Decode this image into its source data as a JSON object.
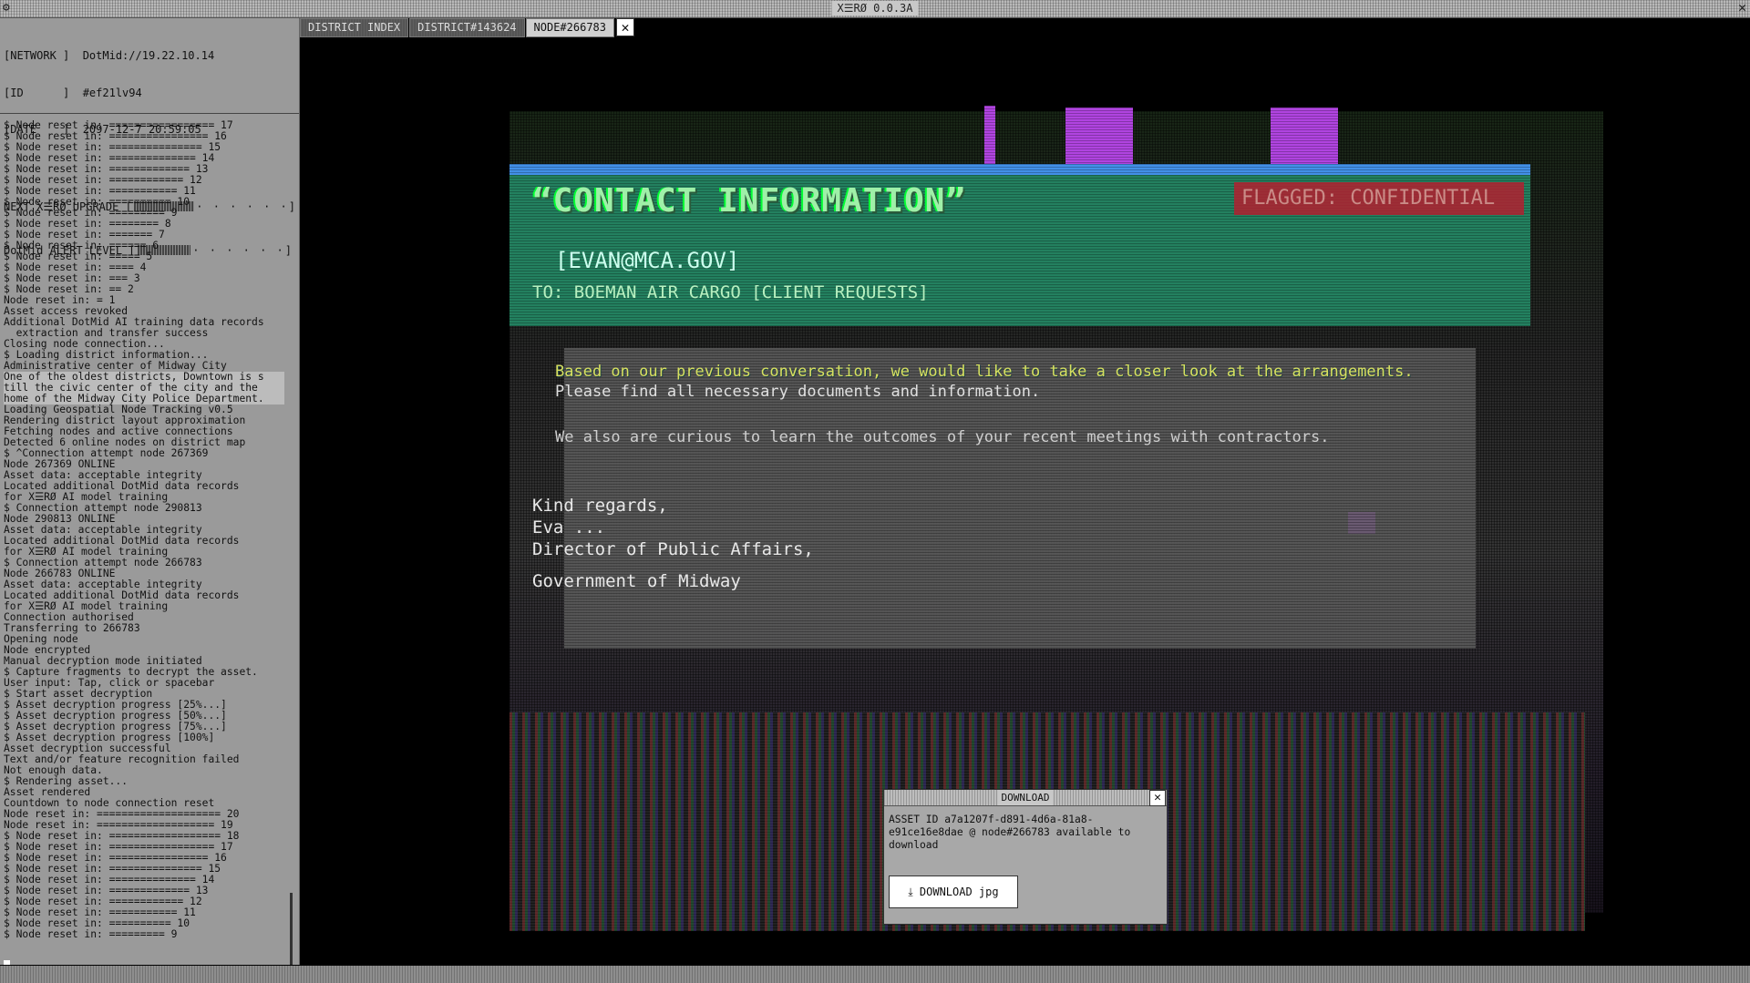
{
  "window": {
    "title": "X☰RØ 0.0.3A",
    "settings_icon": "gear-icon",
    "close_icon": "close-icon"
  },
  "info": {
    "network": "[NETWORK ]  DotMid://19.22.10.14",
    "id": "[ID      ]  #ef21lv94",
    "date": "[DATE    ]  2097-12-7 20:59:05"
  },
  "meters": {
    "upgrade_label": "NEXT X☰RØ UPGRADE [",
    "upgrade_level": 0.45,
    "alert_label": "DotMid ALERT LEVEL [",
    "alert_level": 0.35,
    "dots": "· · · · · ·",
    "close_bracket": "]"
  },
  "log": [
    "$ Node reset in: ================= 17",
    "$ Node reset in: ================ 16",
    "$ Node reset in: =============== 15",
    "$ Node reset in: ============== 14",
    "$ Node reset in: ============= 13",
    "$ Node reset in: ============ 12",
    "$ Node reset in: =========== 11",
    "$ Node reset in: ========== 10",
    "$ Node reset in: ========= 9",
    "$ Node reset in: ======== 8",
    "$ Node reset in: ======= 7",
    "$ Node reset in: ====== 6",
    "$ Node reset in: ===== 5",
    "$ Node reset in: ==== 4",
    "$ Node reset in: === 3",
    "$ Node reset in: == 2",
    "Node reset in: = 1",
    "Asset access revoked",
    "Additional DotMid AI training data records",
    "  extraction and transfer success",
    "Closing node connection...",
    "$ Loading district information...",
    "Administrative center of Midway City",
    "One of the oldest districts, Downtown is s",
    "till the civic center of the city and the",
    "home of the Midway City Police Department.",
    "Loading Geospatial Node Tracking v0.5",
    "Rendering district layout approximation",
    "Fetching nodes and active connections",
    "Detected 6 online nodes on district map",
    "$ ^Connection attempt node 267369",
    "Node 267369 ONLINE",
    "Asset data: acceptable integrity",
    "Located additional DotMid data records",
    "for X☰RØ AI model training",
    "$ Connection attempt node 290813",
    "Node 290813 ONLINE",
    "Asset data: acceptable integrity",
    "Located additional DotMid data records",
    "for X☰RØ AI model training",
    "$ Connection attempt node 266783",
    "Node 266783 ONLINE",
    "Asset data: acceptable integrity",
    "Located additional DotMid data records",
    "for X☰RØ AI model training",
    "Connection authorised",
    "Transferring to 266783",
    "Opening node",
    "Node encrypted",
    "Manual decryption mode initiated",
    "$ Capture fragments to decrypt the asset.",
    "User input: Tap, click or spacebar",
    "$ Start asset decryption",
    "$ Asset decryption progress [25%...]",
    "$ Asset decryption progress [50%...]",
    "$ Asset decryption progress [75%...]",
    "$ Asset decryption progress [100%]",
    "Asset decryption successful",
    "Text and/or feature recognition failed",
    "Not enough data.",
    "$ Rendering asset...",
    "Asset rendered",
    "Countdown to node connection reset",
    "Node reset in: ==================== 20",
    "Node reset in: =================== 19",
    "$ Node reset in: ================== 18",
    "$ Node reset in: ================= 17",
    "$ Node reset in: ================ 16",
    "$ Node reset in: =============== 15",
    "$ Node reset in: ============== 14",
    "$ Node reset in: ============= 13",
    "$ Node reset in: ============ 12",
    "$ Node reset in: =========== 11",
    "$ Node reset in: ========== 10",
    "$ Node reset in: ========= 9"
  ],
  "tabs": [
    "DISTRICT INDEX",
    "DISTRICT#143624",
    "NODE#266783"
  ],
  "tab_close": "✕",
  "asset": {
    "heading": "“CONTACT INFORMATION”",
    "flag": "FLAGGED: CONFIDENTIAL",
    "email": "[EVAN@MCA.GOV]",
    "to_line": "TO: BOEMAN AIR CARGO [CLIENT REQUESTS]",
    "body1": "Based on our previous conversation, we would like to take a closer look at the arrangements.",
    "body2": "Please find all necessary documents and information.",
    "body3": "We also are curious to learn the outcomes of your recent meetings with contractors.",
    "sig1": "Kind regards,",
    "sig2": "Eva ...",
    "sig3": "Director of Public Affairs,",
    "sig4": "Government of Midway"
  },
  "dialog": {
    "title": "DOWNLOAD",
    "close": "✕",
    "message": "ASSET ID a7a1207f-d891-4d6a-81a8-e91ce16e8dae @ node#266783 available to download",
    "button": "⤓  DOWNLOAD jpg"
  }
}
